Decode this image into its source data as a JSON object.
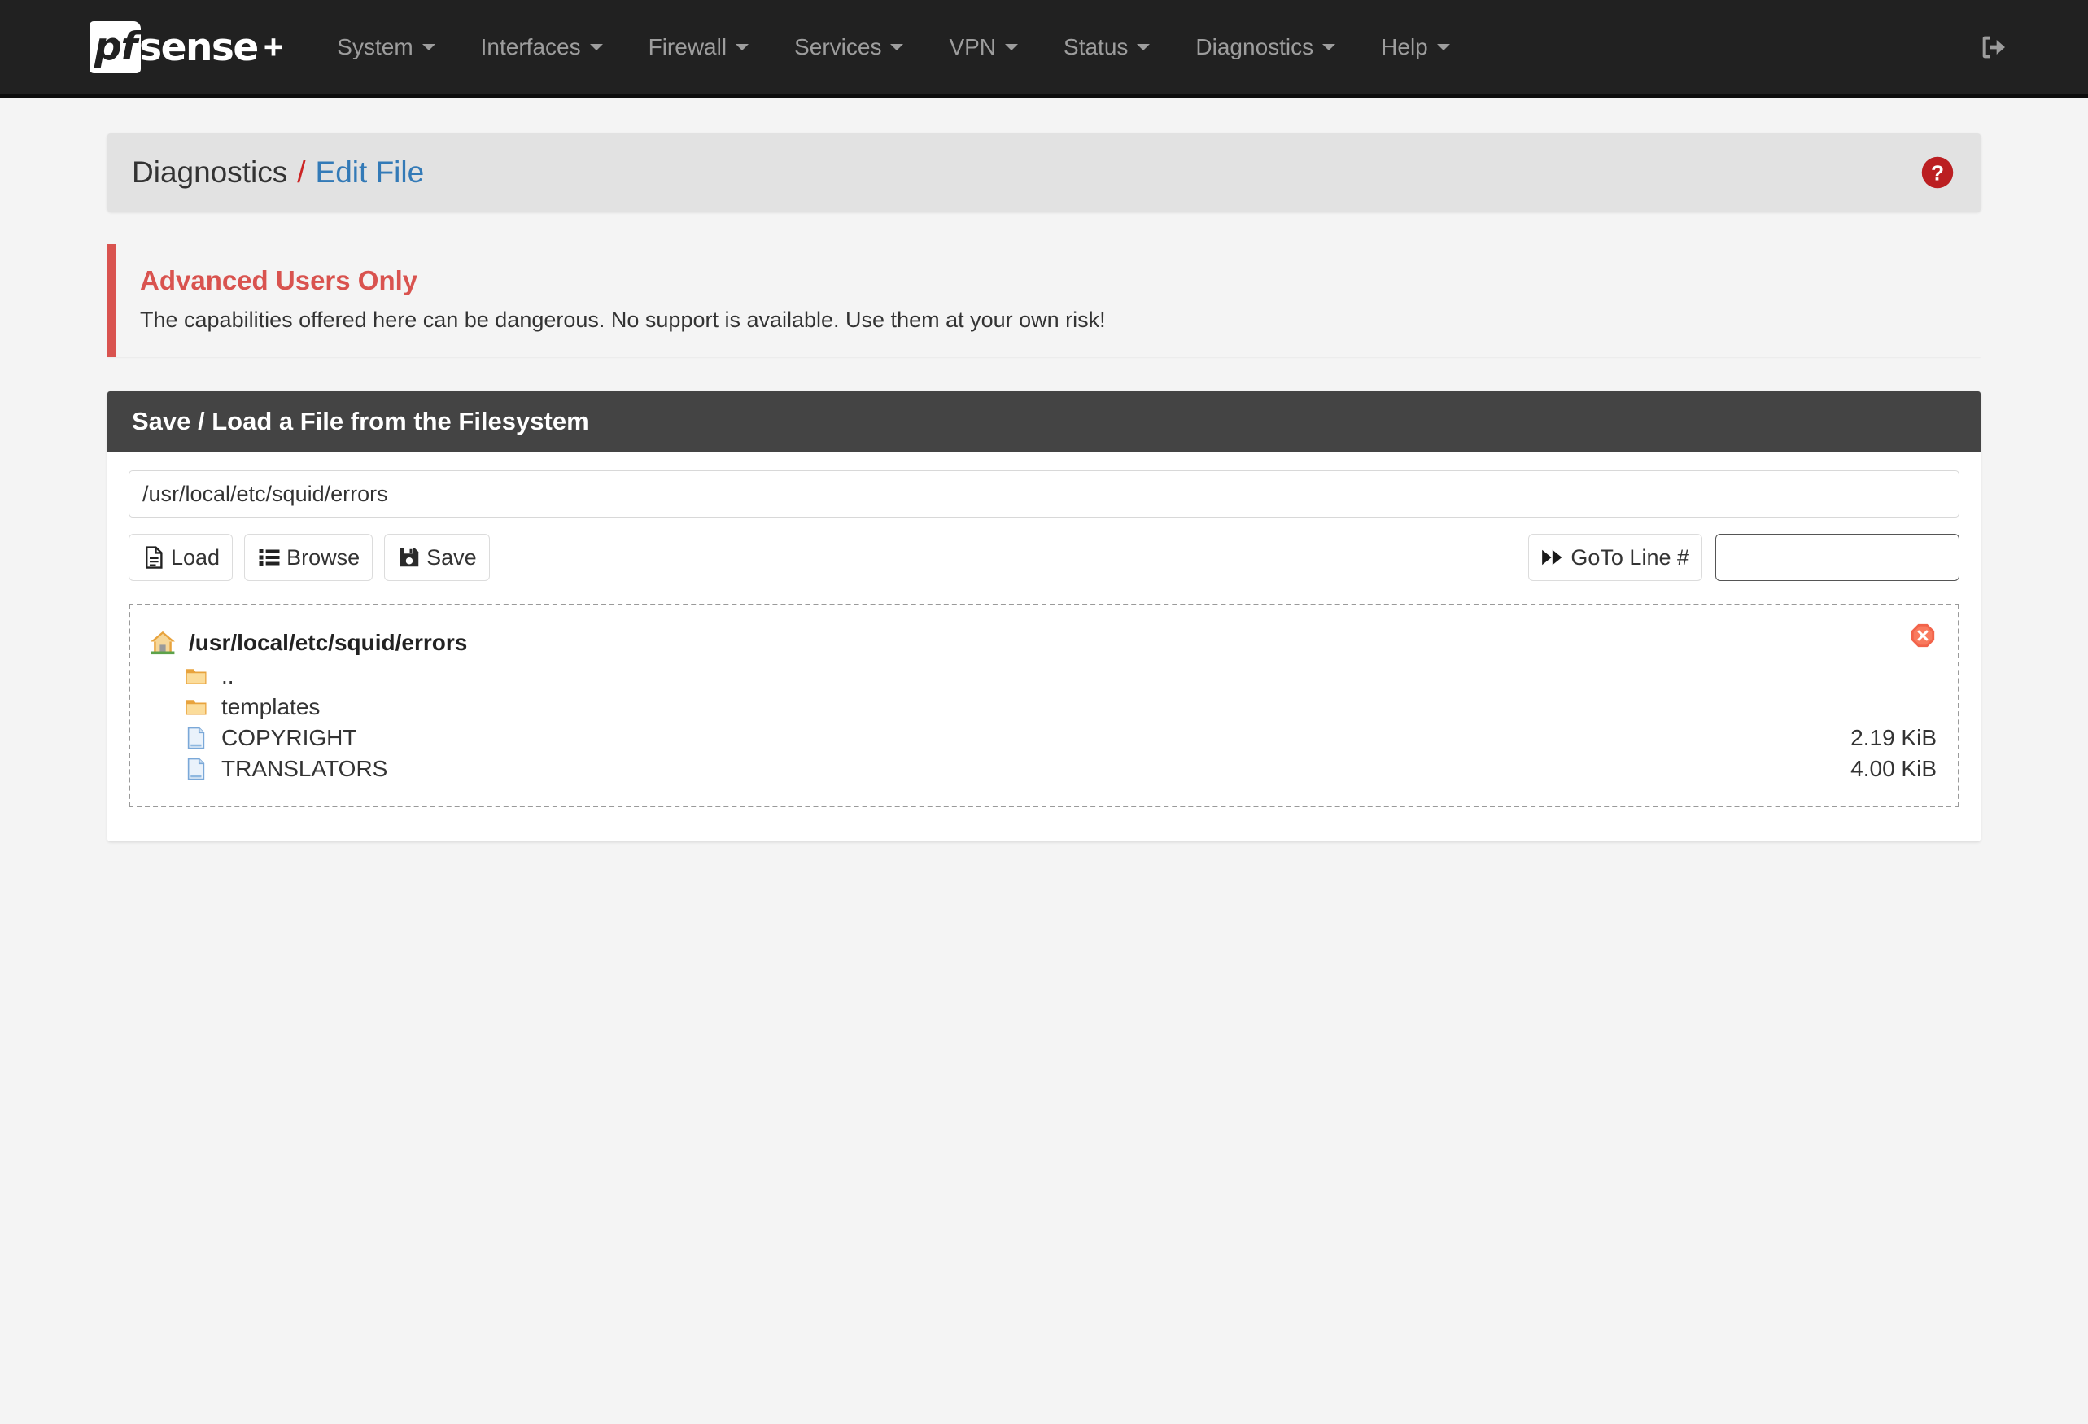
{
  "navbar": {
    "brand": {
      "pf": "pf",
      "sense": "sense",
      "plus": "+",
      "alt": "pfSense Plus"
    },
    "items": [
      {
        "label": "System",
        "icon": "chevron-down-icon"
      },
      {
        "label": "Interfaces",
        "icon": "chevron-down-icon"
      },
      {
        "label": "Firewall",
        "icon": "chevron-down-icon"
      },
      {
        "label": "Services",
        "icon": "chevron-down-icon"
      },
      {
        "label": "VPN",
        "icon": "chevron-down-icon"
      },
      {
        "label": "Status",
        "icon": "chevron-down-icon"
      },
      {
        "label": "Diagnostics",
        "icon": "chevron-down-icon"
      },
      {
        "label": "Help",
        "icon": "chevron-down-icon"
      }
    ],
    "logout_icon": "sign-out-icon"
  },
  "breadcrumb": {
    "root": "Diagnostics",
    "separator": "/",
    "leaf": "Edit File",
    "help_icon": "question-circle-icon"
  },
  "alert": {
    "title": "Advanced Users Only",
    "text": "The capabilities offered here can be dangerous. No support is available. Use them at your own risk!",
    "accent_color": "#d9534f"
  },
  "panel": {
    "heading": "Save / Load a File from the Filesystem",
    "path_field": {
      "value": "/usr/local/etc/squid/errors",
      "placeholder": ""
    },
    "buttons": {
      "load": {
        "label": "Load",
        "icon": "file-text-icon"
      },
      "browse": {
        "label": "Browse",
        "icon": "list-icon"
      },
      "save": {
        "label": "Save",
        "icon": "floppy-disk-icon"
      },
      "goto_line": {
        "label": "GoTo Line #",
        "icon": "fast-forward-icon"
      }
    },
    "line_field": {
      "value": "",
      "placeholder": ""
    }
  },
  "browser": {
    "home_icon": "home-icon",
    "current_path": "/usr/local/etc/squid/errors",
    "close_icon": "close-circle-icon",
    "entries": [
      {
        "name": "..",
        "type": "folder",
        "icon": "folder-icon",
        "size": ""
      },
      {
        "name": "templates",
        "type": "folder",
        "icon": "folder-icon",
        "size": ""
      },
      {
        "name": "COPYRIGHT",
        "type": "file",
        "icon": "file-icon",
        "size": "2.19 KiB"
      },
      {
        "name": "TRANSLATORS",
        "type": "file",
        "icon": "file-icon",
        "size": "4.00 KiB"
      }
    ]
  },
  "colors": {
    "navbar_bg": "#212121",
    "panel_heading_bg": "#444444",
    "link": "#337ab7",
    "danger": "#d9534f",
    "page_bg": "#f4f4f4"
  }
}
